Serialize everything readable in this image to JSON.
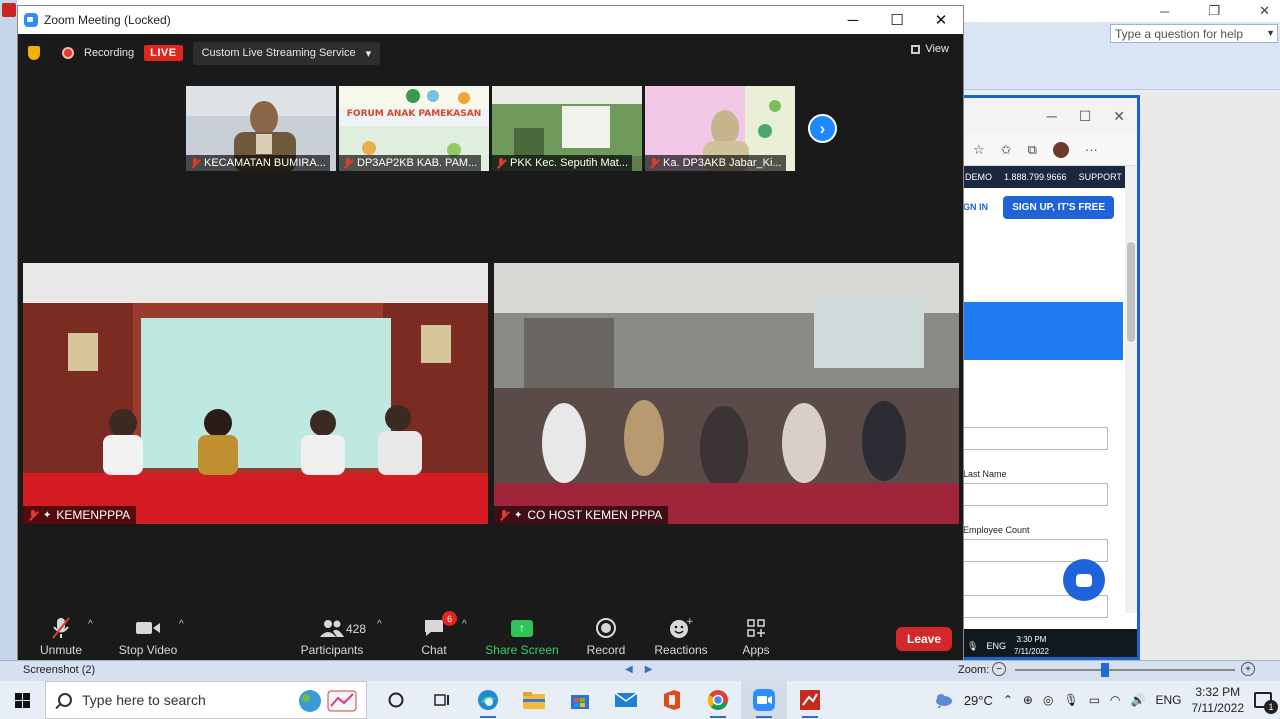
{
  "zoom_window": {
    "title": "Zoom Meeting (Locked)",
    "recording_label": "Recording",
    "live_badge": "LIVE",
    "stream_service_label": "Custom Live Streaming Service",
    "view_label": "View"
  },
  "thumbnails": [
    {
      "name": "KECAMATAN BUMIRA..."
    },
    {
      "name": "DP3AP2KB KAB. PAM...",
      "banner_text": "FORUM ANAK PAMEKASAN"
    },
    {
      "name": "PKK Kec. Seputih Mat..."
    },
    {
      "name": "Ka. DP3AKB Jabar_Ki..."
    }
  ],
  "main_tiles": [
    {
      "name": "KEMENPPPA"
    },
    {
      "name": "CO HOST KEMEN PPPA"
    }
  ],
  "controls": {
    "unmute": "Unmute",
    "stop_video": "Stop Video",
    "participants": "Participants",
    "participants_count": "428",
    "chat": "Chat",
    "chat_badge": "6",
    "share_screen": "Share Screen",
    "record": "Record",
    "reactions": "Reactions",
    "apps": "Apps",
    "leave": "Leave"
  },
  "background_app": {
    "help_placeholder": "Type a question for help",
    "status_text": "Screenshot (2)",
    "zoom_label": "Zoom:",
    "zoom_level": 0.41
  },
  "browser": {
    "nav_demo": "DEMO",
    "nav_phone": "1.888.799.9666",
    "nav_support": "SUPPORT",
    "signin": "GN IN",
    "signup": "SIGN UP, IT'S FREE",
    "last_name_label": "Last Name",
    "employee_count_label": "Employee Count",
    "mini_time": "3:30 PM",
    "mini_date": "7/11/2022",
    "mini_lang": "ENG"
  },
  "taskbar": {
    "search_placeholder": "Type here to search",
    "temperature": "29°C",
    "language": "ENG",
    "time": "3:32 PM",
    "date": "7/11/2022",
    "notification_count": "1"
  },
  "colors": {
    "zoom_blue": "#2d8cff",
    "live_red": "#e0271b",
    "leave_red": "#d4282a",
    "share_green": "#2fc35a"
  }
}
